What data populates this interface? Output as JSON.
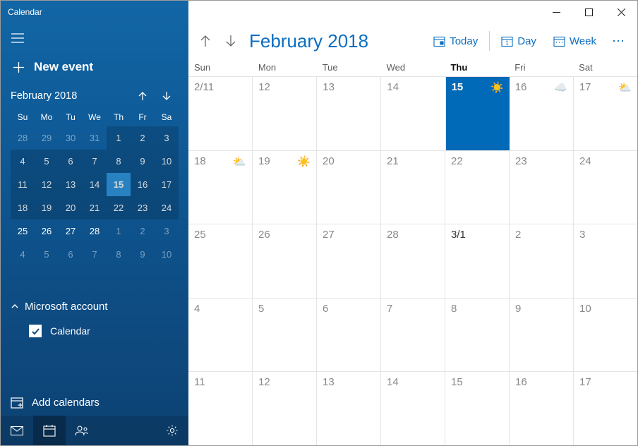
{
  "window": {
    "title": "Calendar"
  },
  "sidebar": {
    "new_event_label": "New event",
    "mini": {
      "title": "February 2018",
      "dow": [
        "Su",
        "Mo",
        "Tu",
        "We",
        "Th",
        "Fr",
        "Sa"
      ],
      "rows": [
        [
          {
            "n": "28",
            "dim": true
          },
          {
            "n": "29",
            "dim": true
          },
          {
            "n": "30",
            "dim": true
          },
          {
            "n": "31",
            "dim": true
          },
          {
            "n": "1"
          },
          {
            "n": "2"
          },
          {
            "n": "3"
          }
        ],
        [
          {
            "n": "4"
          },
          {
            "n": "5"
          },
          {
            "n": "6"
          },
          {
            "n": "7"
          },
          {
            "n": "8"
          },
          {
            "n": "9"
          },
          {
            "n": "10"
          }
        ],
        [
          {
            "n": "11"
          },
          {
            "n": "12"
          },
          {
            "n": "13"
          },
          {
            "n": "14"
          },
          {
            "n": "15",
            "today": true
          },
          {
            "n": "16"
          },
          {
            "n": "17"
          }
        ],
        [
          {
            "n": "18"
          },
          {
            "n": "19"
          },
          {
            "n": "20"
          },
          {
            "n": "21"
          },
          {
            "n": "22"
          },
          {
            "n": "23"
          },
          {
            "n": "24"
          }
        ],
        [
          {
            "n": "25"
          },
          {
            "n": "26"
          },
          {
            "n": "27"
          },
          {
            "n": "28"
          },
          {
            "n": "1",
            "dim": true
          },
          {
            "n": "2",
            "dim": true
          },
          {
            "n": "3",
            "dim": true
          }
        ],
        [
          {
            "n": "4",
            "dim": true
          },
          {
            "n": "5",
            "dim": true
          },
          {
            "n": "6",
            "dim": true
          },
          {
            "n": "7",
            "dim": true
          },
          {
            "n": "8",
            "dim": true
          },
          {
            "n": "9",
            "dim": true
          },
          {
            "n": "10",
            "dim": true
          }
        ]
      ]
    },
    "account": {
      "label": "Microsoft account",
      "calendar_label": "Calendar",
      "calendar_checked": true
    },
    "add_calendars_label": "Add calendars"
  },
  "main": {
    "month_label": "February 2018",
    "buttons": {
      "today": "Today",
      "day": "Day",
      "week": "Week"
    },
    "dow": [
      {
        "label": "Sun"
      },
      {
        "label": "Mon"
      },
      {
        "label": "Tue"
      },
      {
        "label": "Wed"
      },
      {
        "label": "Thu",
        "today": true
      },
      {
        "label": "Fri"
      },
      {
        "label": "Sat"
      }
    ],
    "weeks": [
      [
        {
          "label": "2/11"
        },
        {
          "label": "12"
        },
        {
          "label": "13"
        },
        {
          "label": "14"
        },
        {
          "label": "15",
          "today": true,
          "weather": "sun"
        },
        {
          "label": "16",
          "weather": "cloud"
        },
        {
          "label": "17",
          "weather": "partly"
        }
      ],
      [
        {
          "label": "18",
          "weather": "partly"
        },
        {
          "label": "19",
          "weather": "sun"
        },
        {
          "label": "20"
        },
        {
          "label": "21"
        },
        {
          "label": "22"
        },
        {
          "label": "23"
        },
        {
          "label": "24"
        }
      ],
      [
        {
          "label": "25"
        },
        {
          "label": "26"
        },
        {
          "label": "27"
        },
        {
          "label": "28"
        },
        {
          "label": "3/1",
          "month_start": true
        },
        {
          "label": "2"
        },
        {
          "label": "3"
        }
      ],
      [
        {
          "label": "4"
        },
        {
          "label": "5"
        },
        {
          "label": "6"
        },
        {
          "label": "7"
        },
        {
          "label": "8"
        },
        {
          "label": "9"
        },
        {
          "label": "10"
        }
      ],
      [
        {
          "label": "11"
        },
        {
          "label": "12"
        },
        {
          "label": "13"
        },
        {
          "label": "14"
        },
        {
          "label": "15"
        },
        {
          "label": "16"
        },
        {
          "label": "17"
        }
      ]
    ]
  }
}
